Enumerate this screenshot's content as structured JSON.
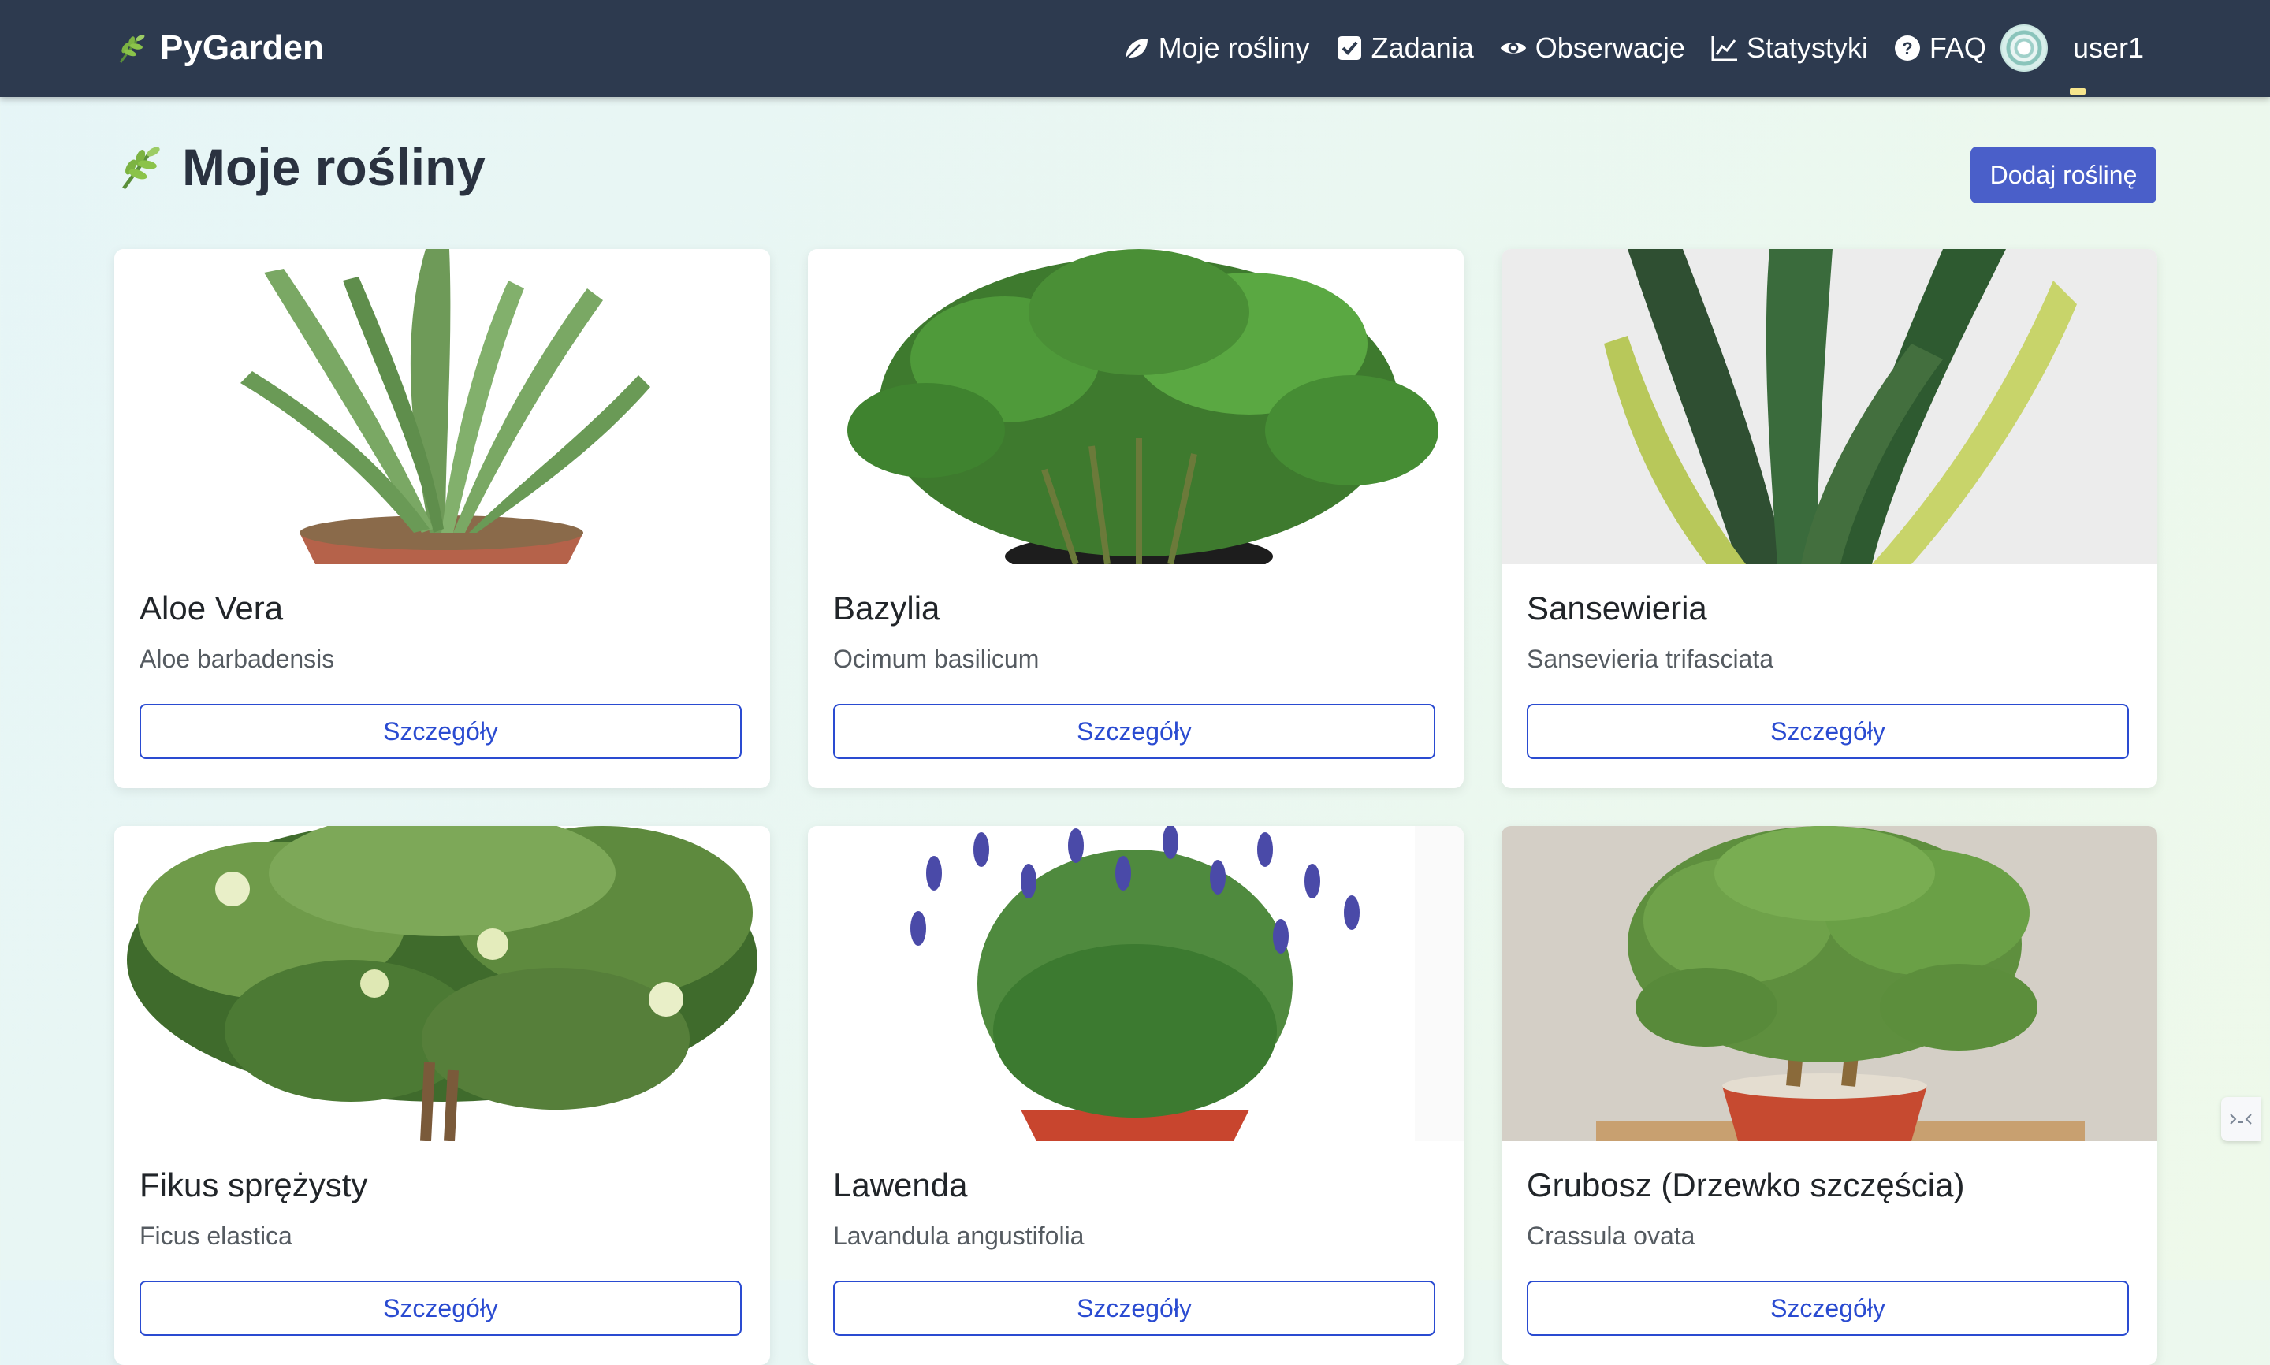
{
  "app": {
    "name": "PyGarden",
    "logo_icon": "herb-icon"
  },
  "nav": {
    "items": [
      {
        "label": "Moje rośliny",
        "icon": "leaf-icon"
      },
      {
        "label": "Zadania",
        "icon": "checkbox-icon"
      },
      {
        "label": "Obserwacje",
        "icon": "eye-icon"
      },
      {
        "label": "Statystyki",
        "icon": "chart-line-icon"
      },
      {
        "label": "FAQ",
        "icon": "question-circle-icon"
      }
    ],
    "username": "user1"
  },
  "page": {
    "title": "Moje rośliny",
    "add_button": "Dodaj roślinę"
  },
  "plants": [
    {
      "name": "Aloe Vera",
      "latin": "Aloe barbadensis",
      "button": "Szczegóły"
    },
    {
      "name": "Bazylia",
      "latin": "Ocimum basilicum",
      "button": "Szczegóły"
    },
    {
      "name": "Sansewieria",
      "latin": "Sansevieria trifasciata",
      "button": "Szczegóły"
    },
    {
      "name": "Fikus sprężysty",
      "latin": "Ficus elastica",
      "button": "Szczegóły"
    },
    {
      "name": "Lawenda",
      "latin": "Lavandula angustifolia",
      "button": "Szczegóły"
    },
    {
      "name": "Grubosz (Drzewko szczęścia)",
      "latin": "Crassula ovata",
      "button": "Szczegóły"
    }
  ],
  "colors": {
    "navbar": "#2d3a4f",
    "primary": "#4a5fc9",
    "outline": "#2a4bd1"
  }
}
